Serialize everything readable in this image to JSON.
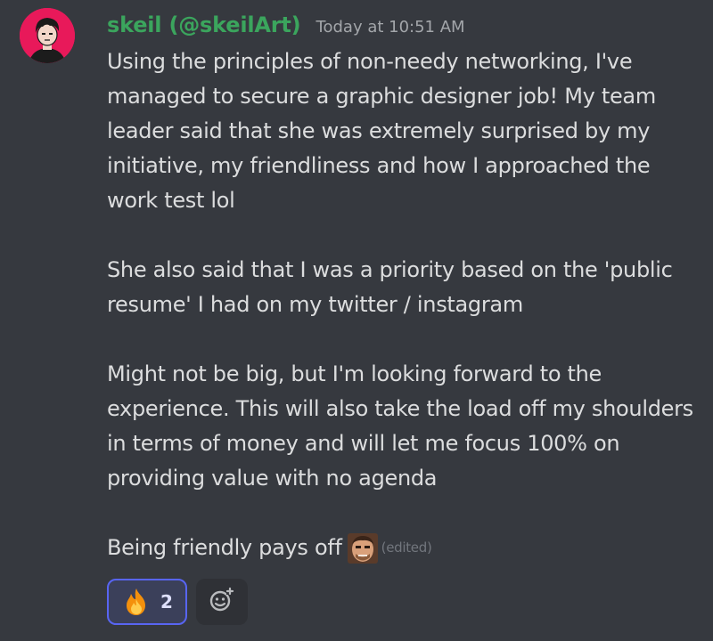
{
  "message": {
    "username": "skeil (@skeilArt)",
    "timestamp": "Today at 10:51 AM",
    "paragraphs": [
      "Using the principles of non-needy networking, I've managed to secure a graphic designer job! My team leader said that she was extremely surprised by my initiative, my friendliness and how I approached the work test lol",
      "She also said that I was a priority based on the 'public resume' I had on my twitter / instagram",
      "Might not be big, but I'm looking forward to the experience. This will also take the load off my shoulders in terms of money and will let me focus 100% on providing value with no agenda"
    ],
    "last_line": "Being friendly pays off",
    "inline_emoji": "custom-face-emoji",
    "edited_label": "(edited)"
  },
  "reactions": [
    {
      "emoji": "fire-emoji",
      "count": "2",
      "selected": true
    }
  ],
  "add_reaction_icon": "add-reaction-icon",
  "colors": {
    "background": "#36393f",
    "username": "#3ba55d",
    "text": "#dcddde",
    "timestamp": "#a3a6aa",
    "reaction_border": "#5865f2",
    "avatar_bg": "#e8195a"
  }
}
